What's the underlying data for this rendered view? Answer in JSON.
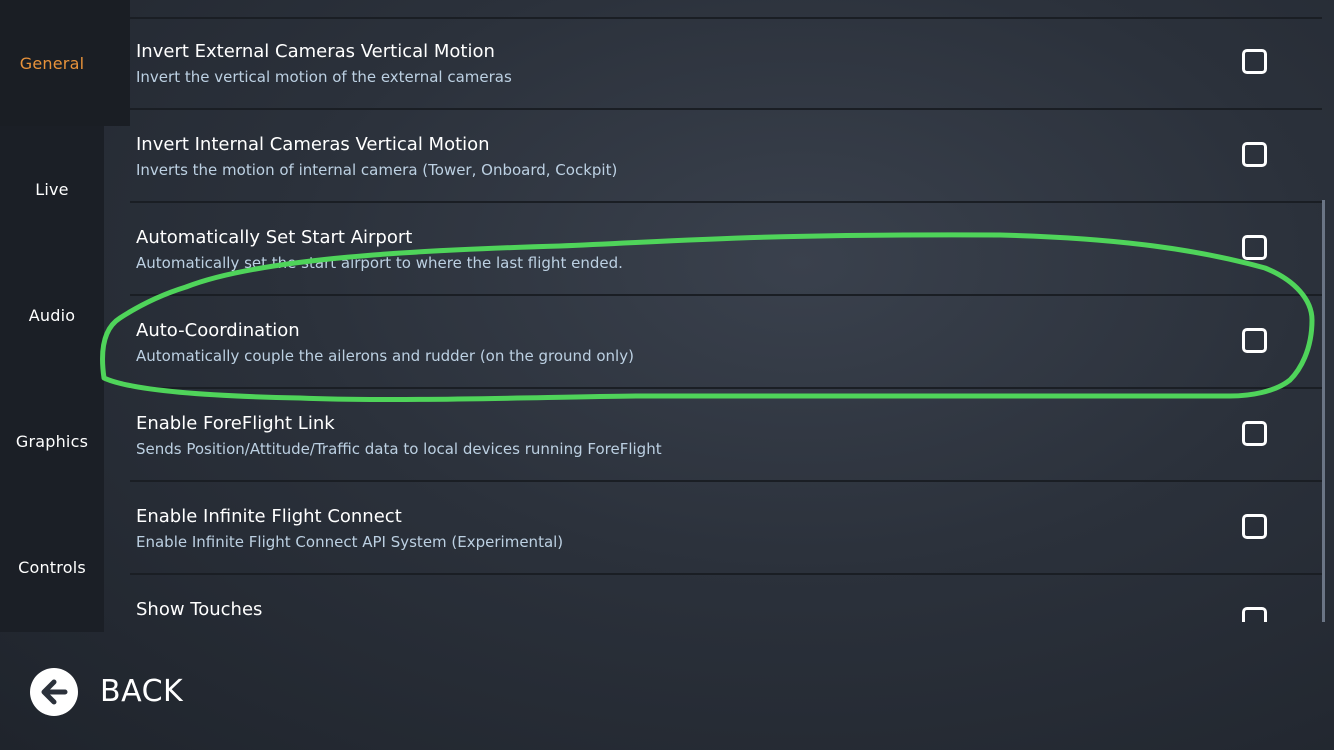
{
  "sidebar": {
    "tabs": [
      {
        "label": "General",
        "active": true
      },
      {
        "label": "Live",
        "active": false
      },
      {
        "label": "Audio",
        "active": false
      },
      {
        "label": "Graphics",
        "active": false
      },
      {
        "label": "Controls",
        "active": false
      }
    ]
  },
  "settings": [
    {
      "title": "Invert External Cameras Vertical Motion",
      "description": "Invert the vertical motion of the external cameras",
      "checked": false
    },
    {
      "title": "Invert Internal Cameras Vertical Motion",
      "description": "Inverts the motion of internal camera (Tower, Onboard, Cockpit)",
      "checked": false
    },
    {
      "title": "Automatically Set Start Airport",
      "description": "Automatically set the start airport to where the last flight ended.",
      "checked": false
    },
    {
      "title": "Auto-Coordination",
      "description": "Automatically couple the ailerons and rudder (on the ground only)",
      "checked": false
    },
    {
      "title": "Enable ForeFlight Link",
      "description": "Sends Position/Attitude/Traffic data to local devices running ForeFlight",
      "checked": false
    },
    {
      "title": "Enable Infinite Flight Connect",
      "description": "Enable Infinite Flight Connect API System (Experimental)",
      "checked": false
    },
    {
      "title": "Show Touches",
      "description": "",
      "checked": false
    }
  ],
  "footer": {
    "back_label": "BACK",
    "back_icon": "arrow-left-circle-icon"
  },
  "colors": {
    "active_tab": "#e8923a",
    "description_text": "#bcd0e2",
    "annotation_stroke": "#4fd45a"
  }
}
